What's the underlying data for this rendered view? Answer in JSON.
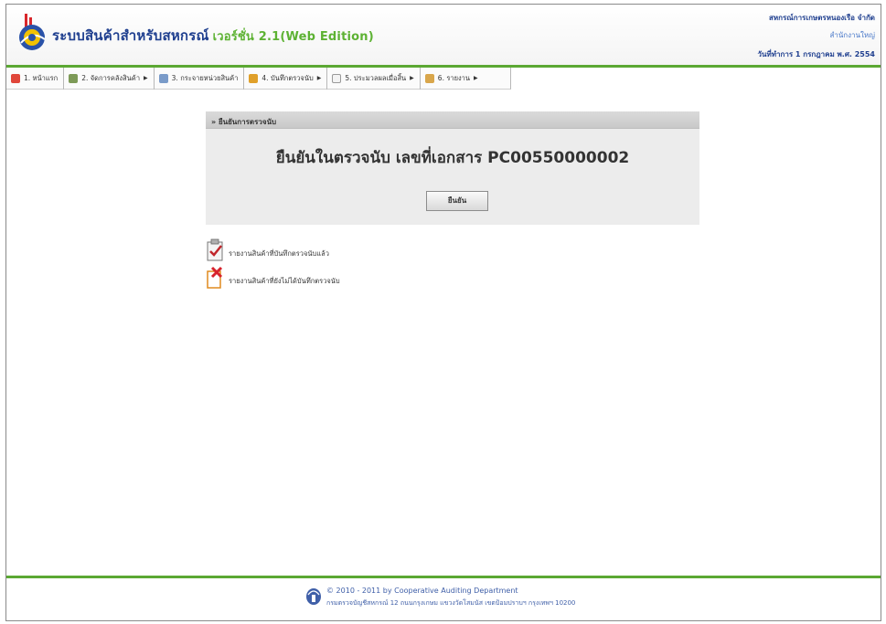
{
  "header": {
    "app_title": "ระบบสินค้าสำหรับสหกรณ์",
    "app_version": "เวอร์ชั่น 2.1(Web Edition)",
    "org_name": "สหกรณ์การเกษตรหนองเรือ จำกัด",
    "org_branch": "สำนักงานใหญ่",
    "work_date": "วันที่ทำการ 1 กรกฎาคม พ.ศ. 2554"
  },
  "menu": {
    "items": [
      {
        "label": "1. หน้าแรก",
        "has_submenu": false,
        "icon": "home-icon"
      },
      {
        "label": "2. จัดการคลังสินค้า",
        "has_submenu": true,
        "icon": "warehouse-icon"
      },
      {
        "label": "3. กระจายหน่วยสินค้า",
        "has_submenu": false,
        "icon": "distribute-icon"
      },
      {
        "label": "4. บันทึกตรวจนับ",
        "has_submenu": true,
        "icon": "count-record-icon"
      },
      {
        "label": "5. ประมวลผลเมื่อสิ้น",
        "has_submenu": true,
        "icon": "process-icon"
      },
      {
        "label": "6. รายงาน",
        "has_submenu": true,
        "icon": "report-icon"
      }
    ]
  },
  "panel": {
    "header": "» ยืนยันการตรวจนับ",
    "title": "ยืนยันในตรวจนับ เลขที่เอกสาร PC00550000002",
    "confirm_label": "ยืนยัน"
  },
  "reports": {
    "counted_label": "รายงานสินค้าที่บันทึกตรวจนับแล้ว",
    "not_counted_label": "รายงานสินค้าที่ยังไม่ได้บันทึกตรวจนับ"
  },
  "footer": {
    "copyright": "© 2010 - 2011 by Cooperative Auditing Department",
    "address": "กรมตรวจบัญชีสหกรณ์ 12 ถนนกรุงเกษม แขวงวัดโสมนัส เขตป้อมปราบฯ กรุงเทพฯ 10200"
  },
  "colors": {
    "accent_green": "#5ba833",
    "title_blue": "#1f3f8f",
    "version_green": "#5db233"
  }
}
